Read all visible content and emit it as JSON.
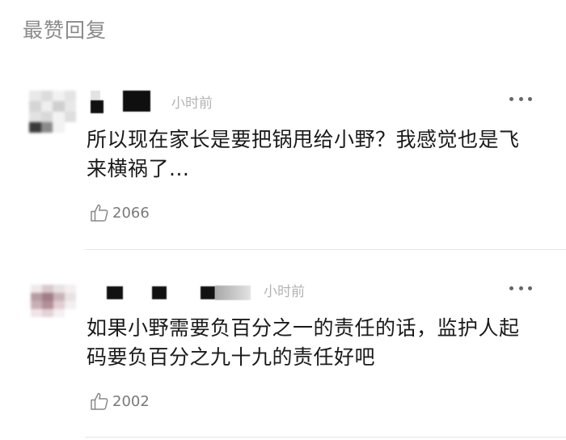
{
  "section": {
    "title": "最赞回复"
  },
  "comments": [
    {
      "time": "小时前",
      "text": "所以现在家长是要把锅甩给小野？我感觉也是飞来横祸了...",
      "likes": "2066",
      "more_icon": "more-icon",
      "like_icon": "thumbs-up-icon"
    },
    {
      "time": "小时前",
      "text": "如果小野需要负百分之一的责任的话，监护人起码要负百分之九十九的责任好吧",
      "likes": "2002",
      "more_icon": "more-icon",
      "like_icon": "thumbs-up-icon"
    }
  ]
}
